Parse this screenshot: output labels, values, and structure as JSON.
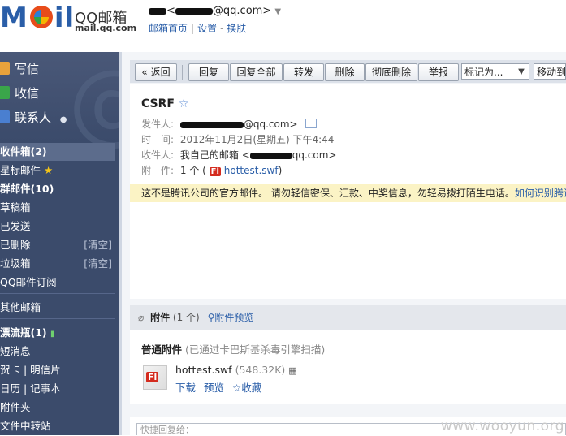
{
  "header": {
    "logo_text": "M  il",
    "brand_title": "QQ邮箱",
    "brand_url": "mail.qq.com",
    "user_email_suffix": "@qq.com>",
    "user_email_prefix": "<",
    "top_links": [
      "邮箱首页",
      "设置",
      "换肤"
    ]
  },
  "sidebar": {
    "big_nav": [
      {
        "label": "写信",
        "icon": "compose-icon"
      },
      {
        "label": "收信",
        "icon": "inbox-download-icon"
      },
      {
        "label": "联系人",
        "icon": "contacts-icon"
      }
    ],
    "folders": [
      {
        "label": "收件箱(2)",
        "bold": true,
        "selected": true
      },
      {
        "label": "星标邮件",
        "star": true
      },
      {
        "label": "群邮件(10)",
        "bold": true
      },
      {
        "label": "草稿箱"
      },
      {
        "label": "已发送"
      },
      {
        "label": "已删除",
        "action": "[清空]"
      },
      {
        "label": "垃圾箱",
        "action": "[清空]"
      },
      {
        "label": "QQ邮件订阅"
      },
      {
        "label": "其他邮箱"
      },
      {
        "label": "漂流瓶(1)",
        "bold": true
      },
      {
        "label": "短消息"
      },
      {
        "label": "贺卡 | 明信片"
      },
      {
        "label": "日历 | 记事本"
      },
      {
        "label": "附件夹"
      },
      {
        "label": "文件中转站"
      }
    ]
  },
  "toolbar": {
    "back": "« 返回",
    "reply": "回复",
    "reply_all": "回复全部",
    "forward": "转发",
    "delete": "删除",
    "delete_permanent": "彻底删除",
    "report": "举报",
    "mark_as": "标记为...",
    "move_to": "移动到"
  },
  "mail": {
    "subject": "CSRF",
    "from_label": "发件人:",
    "from_value": "@qq.com>",
    "time_label": "时　间:",
    "time_value": "2012年11月2日(星期五) 下午4:44",
    "to_label": "收件人:",
    "to_value_prefix": "我自己的邮箱 <",
    "to_value_suffix": "qq.com>",
    "att_label": "附　件:",
    "att_count": "1 个 (",
    "att_name": "hottest.swf",
    "att_close": ")"
  },
  "warning": {
    "text": "这不是腾讯公司的官方邮件。 请勿轻信密保、汇款、中奖信息，勿轻易拨打陌生电话。",
    "link": "如何识别腾讯"
  },
  "attachments": {
    "title": "附件",
    "count": "(1 个)",
    "preview": "附件预览",
    "section_label": "普通附件",
    "scan_note": "(已通过卡巴斯基杀毒引擎扫描)",
    "file_name": "hottest.swf",
    "file_size": "(548.32K)",
    "actions": [
      "下载",
      "预览",
      "☆收藏"
    ],
    "file_type_badge": "Fl"
  },
  "reply": {
    "placeholder": "快捷回复给："
  },
  "watermark": "www.wooyun.org",
  "colors": {
    "sidebar": "#3b4b6b",
    "link": "#2a5ea8",
    "warning_bg": "#fbf3c5"
  }
}
